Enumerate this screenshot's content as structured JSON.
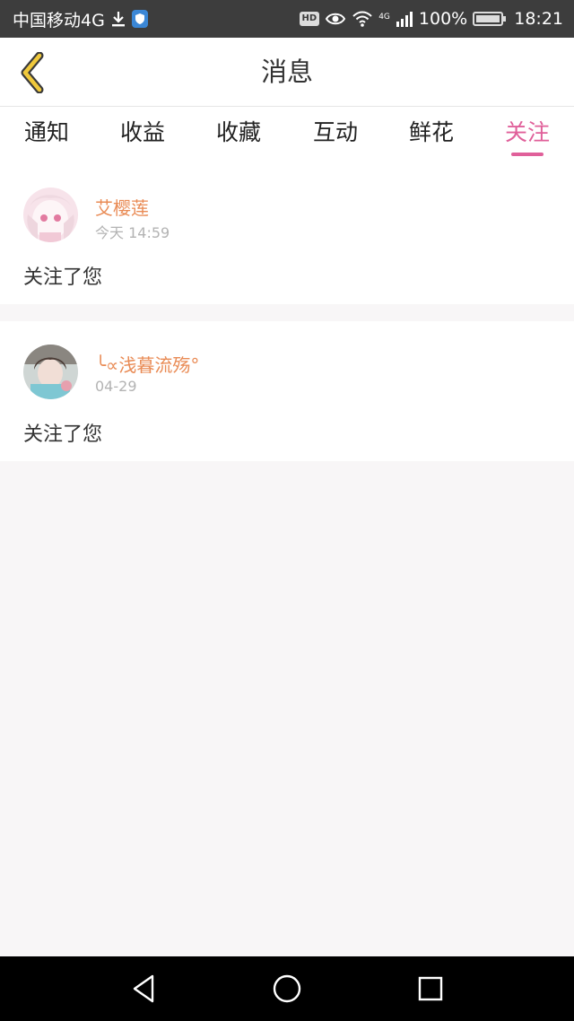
{
  "status_bar": {
    "carrier": "中国移动4G",
    "hd": "HD",
    "signal_label": "4G",
    "battery": "100%",
    "time": "18:21",
    "battery_level": 1.0
  },
  "header": {
    "title": "消息",
    "back_icon": "chevron-left-icon"
  },
  "tabs": [
    {
      "label": "通知",
      "active": false
    },
    {
      "label": "收益",
      "active": false
    },
    {
      "label": "收藏",
      "active": false
    },
    {
      "label": "互动",
      "active": false
    },
    {
      "label": "鲜花",
      "active": false
    },
    {
      "label": "关注",
      "active": true
    }
  ],
  "messages": [
    {
      "username": "艾樱莲",
      "time": "今天 14:59",
      "text": "关注了您"
    },
    {
      "username": "╰∝浅暮流殇°",
      "time": "04-29",
      "text": "关注了您"
    }
  ],
  "colors": {
    "accent": "#e0609a",
    "username": "#e98b55",
    "back_icon": "#f0c93c"
  }
}
